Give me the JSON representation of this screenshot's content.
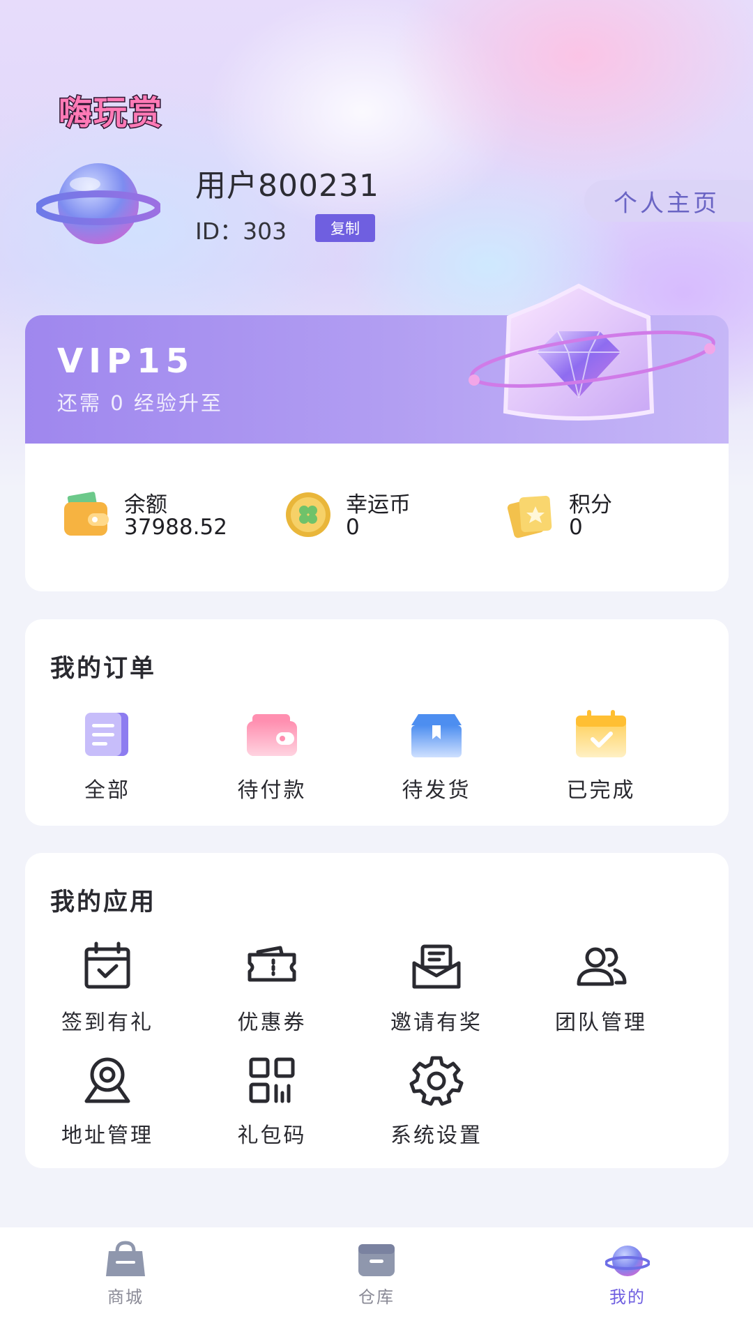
{
  "app": {
    "logo_text": "嗨玩赏"
  },
  "profile": {
    "username": "用户800231",
    "id_label": "ID：303",
    "copy_label": "复制",
    "home_label": "个人主页"
  },
  "vip": {
    "level": "VIP15",
    "subtitle": "还需 0 经验升至"
  },
  "stats": [
    {
      "label": "余额",
      "value": "37988.52",
      "icon": "wallet-icon"
    },
    {
      "label": "幸运币",
      "value": "0",
      "icon": "lucky-coin-icon"
    },
    {
      "label": "积分",
      "value": "0",
      "icon": "points-cards-icon"
    }
  ],
  "orders": {
    "title": "我的订单",
    "items": [
      {
        "label": "全部",
        "icon": "all-orders-icon"
      },
      {
        "label": "待付款",
        "icon": "pending-payment-icon"
      },
      {
        "label": "待发货",
        "icon": "pending-shipment-icon"
      },
      {
        "label": "已完成",
        "icon": "completed-icon"
      }
    ]
  },
  "apps": {
    "title": "我的应用",
    "items": [
      {
        "label": "签到有礼",
        "icon": "calendar-check-icon"
      },
      {
        "label": "优惠券",
        "icon": "coupon-icon"
      },
      {
        "label": "邀请有奖",
        "icon": "invite-mail-icon"
      },
      {
        "label": "团队管理",
        "icon": "team-icon"
      },
      {
        "label": "地址管理",
        "icon": "location-pin-icon"
      },
      {
        "label": "礼包码",
        "icon": "qr-code-icon"
      },
      {
        "label": "系统设置",
        "icon": "gear-icon"
      }
    ]
  },
  "tabbar": {
    "items": [
      {
        "label": "商城",
        "icon": "shopping-bag-icon",
        "active": false
      },
      {
        "label": "仓库",
        "icon": "box-icon",
        "active": false
      },
      {
        "label": "我的",
        "icon": "planet-icon",
        "active": true
      }
    ]
  },
  "colors": {
    "accent": "#6f5fe0",
    "vip_gradient_start": "#9f87ee",
    "vip_gradient_end": "#c6b7f7",
    "page_background": "#f2f3fa"
  }
}
